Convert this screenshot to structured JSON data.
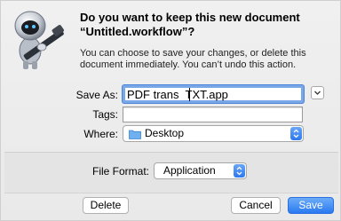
{
  "dialog": {
    "title_line1": "Do you want to keep this new document",
    "title_line2": "“Untitled.workflow”?",
    "message": "You can choose to save your changes, or delete this document immediately. You can’t undo this action."
  },
  "form": {
    "save_as_label": "Save As:",
    "save_as_value": "PDF trans  TXT.app",
    "tags_label": "Tags:",
    "tags_value": "",
    "where_label": "Where:",
    "where_value": "Desktop",
    "file_format_label": "File Format:",
    "file_format_value": "Application"
  },
  "buttons": {
    "delete": "Delete",
    "cancel": "Cancel",
    "save": "Save"
  },
  "icons": {
    "app": "automator-robot-icon",
    "folder": "folder-icon",
    "expand": "chevron-down-icon",
    "stepper": "up-down-arrows-icon"
  },
  "colors": {
    "accent": "#2b78ef",
    "focus_ring": "#7aa7e8"
  }
}
